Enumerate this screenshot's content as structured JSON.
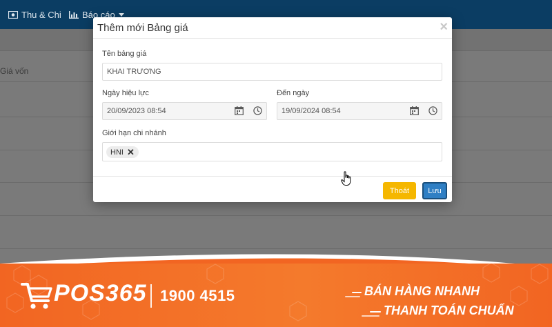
{
  "nav": {
    "items": [
      {
        "label": "Thu & Chi",
        "icon": "money-icon"
      },
      {
        "label": "Báo cáo",
        "icon": "bar-chart-icon"
      }
    ]
  },
  "table": {
    "column_header": "Giá vốn"
  },
  "modal": {
    "title": "Thêm mới Bảng giá",
    "fields": {
      "name": {
        "label": "Tên bảng giá",
        "value": "KHAI TRƯƠNG"
      },
      "start": {
        "label": "Ngày hiệu lực",
        "value": "20/09/2023 08:54"
      },
      "end": {
        "label": "Đến ngày",
        "value": "19/09/2024 08:54"
      },
      "branch": {
        "label": "Giới hạn chi nhánh",
        "tags": [
          "HNI"
        ]
      }
    },
    "buttons": {
      "exit": "Thoát",
      "save": "Lưu"
    }
  },
  "banner": {
    "logo": "POS365",
    "hotline": "1900 4515",
    "slogan_1": "BÁN HÀNG NHANH",
    "slogan_2": "THANH TOÁN CHUẨN"
  },
  "colors": {
    "topbar": "#0b3d63",
    "banner": "#f26522",
    "exit_button": "#f5b700",
    "save_button": "#2f7fc4"
  }
}
